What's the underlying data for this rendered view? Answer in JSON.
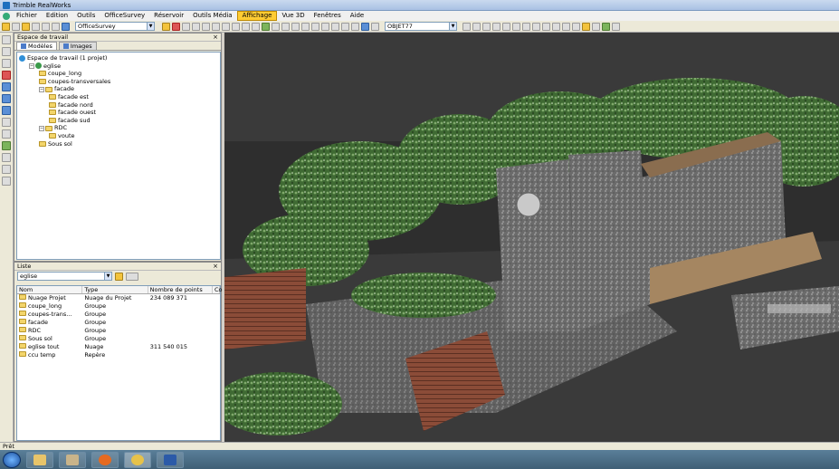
{
  "window": {
    "title": "Trimble RealWorks"
  },
  "menu": [
    "Fichier",
    "Edition",
    "Outils",
    "OfficeSurvey",
    "Réservoir",
    "Outils Média",
    "Affichage",
    "Vue 3D",
    "Fenêtres",
    "Aide"
  ],
  "menu_active": "Affichage",
  "toolbar": {
    "mode_combo": "OfficeSurvey",
    "object_combo": "OBJET77"
  },
  "workspace": {
    "title": "Espace de travail",
    "tabs": [
      "Modèles",
      "Images"
    ],
    "tree": [
      {
        "label": "Espace de travail (1 projet)",
        "level": 0,
        "icon": "globe-icon"
      },
      {
        "label": "eglise",
        "level": 1,
        "icon": "project-icon"
      },
      {
        "label": "coupe_long",
        "level": 2,
        "icon": "folder-icon"
      },
      {
        "label": "coupes-transversales",
        "level": 2,
        "icon": "folder-icon"
      },
      {
        "label": "facade",
        "level": 2,
        "icon": "folder-icon"
      },
      {
        "label": "facade est",
        "level": 3,
        "icon": "folder-icon"
      },
      {
        "label": "facade nord",
        "level": 3,
        "icon": "folder-icon"
      },
      {
        "label": "facade ouest",
        "level": 3,
        "icon": "folder-icon"
      },
      {
        "label": "facade sud",
        "level": 3,
        "icon": "folder-icon"
      },
      {
        "label": "RDC",
        "level": 2,
        "icon": "folder-icon"
      },
      {
        "label": "voute",
        "level": 3,
        "icon": "folder-icon"
      },
      {
        "label": "Sous sol",
        "level": 2,
        "icon": "folder-icon"
      }
    ]
  },
  "list": {
    "title": "Liste",
    "combo": "eglise",
    "columns": [
      "Nom",
      "Type",
      "Nombre de points",
      "Co"
    ],
    "rows": [
      [
        "Nuage Projet",
        "Nuage du Projet",
        "234 089 371",
        ""
      ],
      [
        "coupe_long",
        "Groupe",
        "",
        ""
      ],
      [
        "coupes-trans...",
        "Groupe",
        "",
        ""
      ],
      [
        "facade",
        "Groupe",
        "",
        ""
      ],
      [
        "RDC",
        "Groupe",
        "",
        ""
      ],
      [
        "Sous sol",
        "Groupe",
        "",
        ""
      ],
      [
        "eglise tout",
        "Nuage",
        "311 540 015",
        ""
      ],
      [
        "ccu temp",
        "Repère",
        "",
        ""
      ]
    ]
  },
  "status": "Prêt"
}
